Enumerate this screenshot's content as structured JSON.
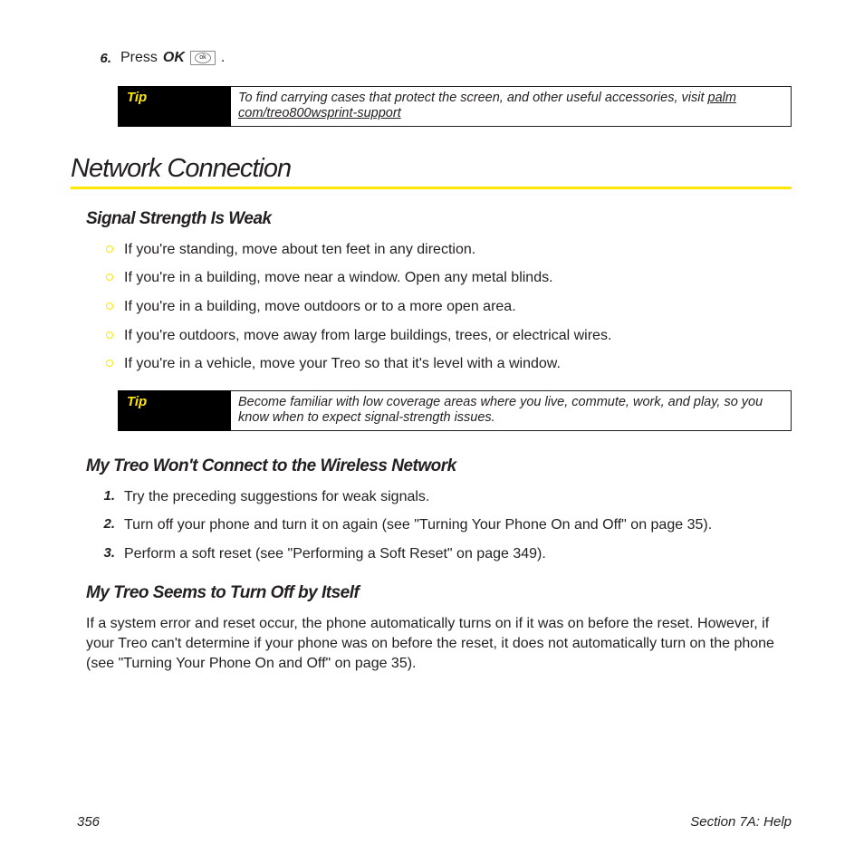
{
  "step6": {
    "num": "6.",
    "prefix": "Press",
    "cmd": "OK",
    "key_label": "ok",
    "suffix": "."
  },
  "tip1": {
    "label": "Tip",
    "text_a": "To find carrying cases that protect the screen, and other useful accessories, visit ",
    "link": "palm com/treo800wsprint-support"
  },
  "section_title": "Network Connection",
  "subhead1": "Signal Strength Is Weak",
  "bullets1": [
    "If you're standing, move about ten feet in any direction.",
    "If you're in a building, move near a window. Open any metal blinds.",
    "If you're in a building, move outdoors or to a more open area.",
    "If you're outdoors, move away from large buildings, trees, or electrical wires.",
    "If you're in a vehicle, move your Treo so that it's level with a window."
  ],
  "tip2": {
    "label": "Tip",
    "text": "Become familiar with low coverage areas where you live, commute, work, and play, so you know when to expect signal-strength issues."
  },
  "subhead2": "My Treo Won't Connect to the Wireless Network",
  "steps2": [
    {
      "num": "1.",
      "text": "Try the preceding suggestions for weak signals."
    },
    {
      "num": "2.",
      "text": "Turn off your phone and turn it on again (see \"Turning Your Phone On and Off\" on page 35)."
    },
    {
      "num": "3.",
      "text": "Perform a soft reset (see \"Performing a Soft Reset\" on page 349)."
    }
  ],
  "subhead3": "My Treo Seems to Turn Off by Itself",
  "para3": "If a system error and reset occur, the phone automatically turns on if it was on before the reset. However, if your Treo can't determine if your phone was on before the reset, it does not automatically turn on the phone (see \"Turning Your Phone On and Off\" on page 35).",
  "footer": {
    "page": "356",
    "section": "Section 7A: Help"
  }
}
